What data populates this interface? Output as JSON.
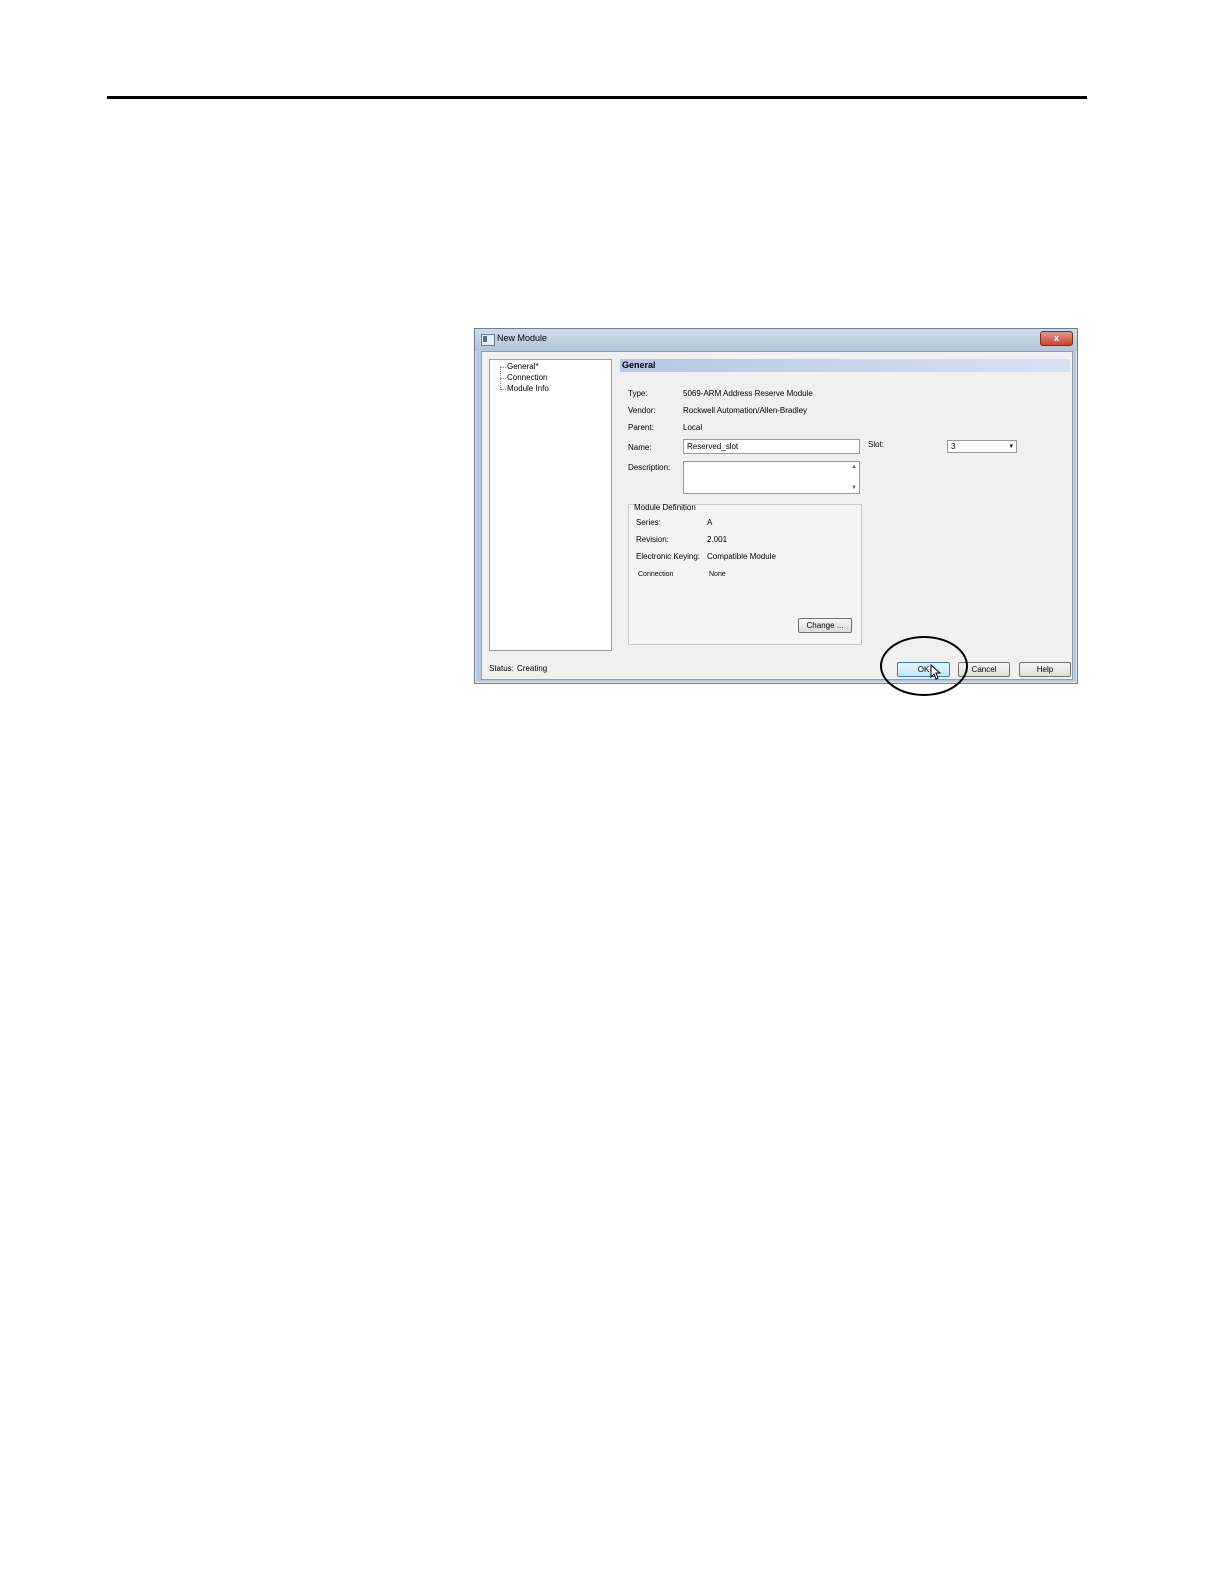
{
  "window": {
    "title": "New Module",
    "close_glyph": "x"
  },
  "nav": {
    "items": [
      "General*",
      "Connection",
      "Module Info"
    ]
  },
  "section": {
    "title": "General"
  },
  "form": {
    "type_label": "Type:",
    "type_value": "5069-ARM Address Reserve Module",
    "vendor_label": "Vendor:",
    "vendor_value": "Rockwell Automation/Allen-Bradley",
    "parent_label": "Parent:",
    "parent_value": "Local",
    "name_label": "Name:",
    "name_value": "Reserved_slot",
    "slot_label": "Slot:",
    "slot_value": "3",
    "description_label": "Description:",
    "description_value": ""
  },
  "module_definition": {
    "title": "Module Definition",
    "series_label": "Series:",
    "series_value": "A",
    "revision_label": "Revision:",
    "revision_value": "2.001",
    "keying_label": "Electronic Keying:",
    "keying_value": "Compatible Module",
    "connection_label": "Connection",
    "connection_value": "None",
    "change_button": "Change ..."
  },
  "footer": {
    "status_label": "Status:",
    "status_value": "Creating",
    "ok_button": "OK",
    "cancel_button": "Cancel",
    "help_button": "Help"
  },
  "icons": {
    "window_icon": "module-window-icon",
    "close": "close-icon",
    "dropdown": "chevron-down-icon",
    "cursor": "mouse-pointer-icon"
  },
  "colors": {
    "titlebar": "#b9c9dc",
    "close_button": "#c4452c",
    "section_header": "#b6c7e6",
    "focused_button": "#bee6fd"
  }
}
